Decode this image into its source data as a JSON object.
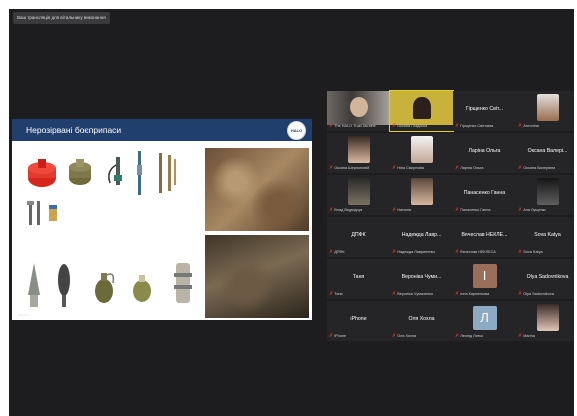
{
  "window": {
    "title": "Ваш трансляція для вітальнику виконання"
  },
  "slide": {
    "title": "Нерозірвані боєприпаси",
    "logo": "HALO",
    "pager": "○○○○"
  },
  "participants": [
    {
      "center": "",
      "label": "The HALO Trust Ukraine",
      "kind": "video-man"
    },
    {
      "center": "",
      "label": "Оксана Гладська",
      "kind": "video-woman",
      "active": true
    },
    {
      "center": "Гірщенко Світ...",
      "label": "Гірщенко Світлана"
    },
    {
      "center": "",
      "label": "Антоніна",
      "kind": "photo-cartoon"
    },
    {
      "center": "",
      "label": "Оксана Шерлоновій",
      "kind": "photo-girl"
    },
    {
      "center": "",
      "label": "Ніна Смирнова",
      "kind": "photo-woman2"
    },
    {
      "center": "Ларіна Ольга",
      "label": "Ларіна Ольга"
    },
    {
      "center": "Оксана Валері...",
      "label": "Оксана Валерівна"
    },
    {
      "center": "",
      "label": "Влад Ведмідчук",
      "kind": "photo-dark"
    },
    {
      "center": "",
      "label": "Наталія",
      "kind": "video-woman3"
    },
    {
      "center": "Панасенко Ганна",
      "label": "Панасенко Ганна"
    },
    {
      "center": "",
      "label": "Аня Лущенко",
      "kind": "photo-dark2"
    },
    {
      "center": "ДПФК",
      "label": "ДПФК"
    },
    {
      "center": "Надежда Лавр...",
      "label": "Надежда Лавриненко"
    },
    {
      "center": "Вячеслав НЕКЛЕ...",
      "label": "Вячеслав НЕКЛЕСА"
    },
    {
      "center": "Sova Katya",
      "label": "Sova Katya"
    },
    {
      "center": "Таня",
      "label": "Таня"
    },
    {
      "center": "Вероніка Чуми...",
      "label": "Вероніка Чумаченко"
    },
    {
      "center": "",
      "label": "Інна Карпенкова",
      "kind": "letter",
      "letter": "І",
      "color": "#9b6e5c"
    },
    {
      "center": "Olya Sadovnikova",
      "label": "Olya Sadovnikova"
    },
    {
      "center": "iPhone",
      "label": "iPhone"
    },
    {
      "center": "Оля Хохла",
      "label": "Оля Хохла"
    },
    {
      "center": "",
      "label": "Леонід Лятко",
      "kind": "letter",
      "letter": "Л",
      "color": "#8ea9c2"
    },
    {
      "center": "",
      "label": "Marina",
      "kind": "photo-girl2"
    }
  ]
}
